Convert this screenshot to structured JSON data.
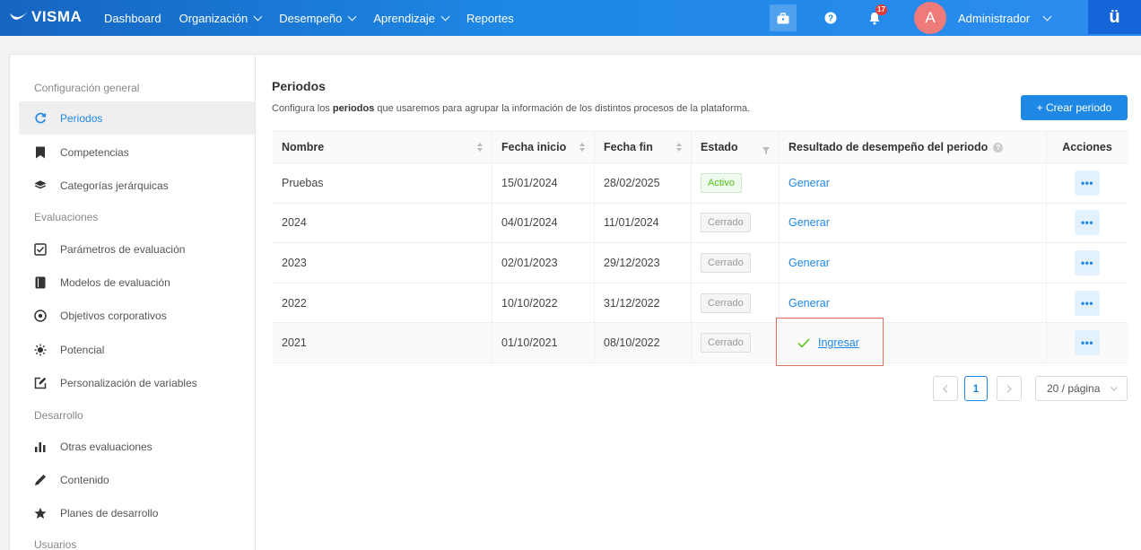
{
  "topbar": {
    "brand": "VISMA",
    "nav": [
      {
        "label": "Dashboard",
        "has_menu": false
      },
      {
        "label": "Organización",
        "has_menu": true
      },
      {
        "label": "Desempeño",
        "has_menu": true
      },
      {
        "label": "Aprendizaje",
        "has_menu": true
      },
      {
        "label": "Reportes",
        "has_menu": false
      }
    ],
    "notification_count": "17",
    "avatar_initial": "A",
    "user_name": "Administrador",
    "app_badge": "ü"
  },
  "sidebar": {
    "sections": [
      {
        "title": "Configuración general",
        "items": [
          {
            "label": "Periodos",
            "icon": "refresh-icon",
            "active": true
          },
          {
            "label": "Competencias",
            "icon": "bookmark-icon"
          },
          {
            "label": "Categorías jerárquicas",
            "icon": "layers-icon"
          }
        ]
      },
      {
        "title": "Evaluaciones",
        "items": [
          {
            "label": "Parámetros de evaluación",
            "icon": "checkbox-icon"
          },
          {
            "label": "Modelos de evaluación",
            "icon": "notebook-icon"
          },
          {
            "label": "Objetivos corporativos",
            "icon": "target-icon"
          },
          {
            "label": "Potencial",
            "icon": "sun-icon"
          },
          {
            "label": "Personalización de variables",
            "icon": "edit-icon"
          }
        ]
      },
      {
        "title": "Desarrollo",
        "items": [
          {
            "label": "Otras evaluaciones",
            "icon": "bar-chart-icon"
          },
          {
            "label": "Contenido",
            "icon": "pen-icon"
          },
          {
            "label": "Planes de desarrollo",
            "icon": "star-icon"
          }
        ]
      },
      {
        "title": "Usuarios",
        "items": []
      }
    ]
  },
  "main": {
    "title": "Periodos",
    "description_pre": "Configura los ",
    "description_bold": "periodos",
    "description_post": " que usaremos para agrupar la información de los distintos procesos de la plataforma.",
    "create_button": "+ Crear periodo",
    "table": {
      "headers": [
        "Nombre",
        "Fecha inicio",
        "Fecha fin",
        "Estado",
        "Resultado de desempeño del periodo",
        "Acciones"
      ],
      "rows": [
        {
          "nombre": "Pruebas",
          "inicio": "15/01/2024",
          "fin": "28/02/2025",
          "estado": "Activo",
          "resultado": "Generar"
        },
        {
          "nombre": "2024",
          "inicio": "04/01/2024",
          "fin": "11/01/2024",
          "estado": "Cerrado",
          "resultado": "Generar"
        },
        {
          "nombre": "2023",
          "inicio": "02/01/2023",
          "fin": "29/12/2023",
          "estado": "Cerrado",
          "resultado": "Generar"
        },
        {
          "nombre": "2022",
          "inicio": "10/10/2022",
          "fin": "31/12/2022",
          "estado": "Cerrado",
          "resultado": "Generar"
        },
        {
          "nombre": "2021",
          "inicio": "01/10/2021",
          "fin": "08/10/2022",
          "estado": "Cerrado",
          "resultado": "Ingresar"
        }
      ],
      "actions_label": "•••"
    },
    "pagination": {
      "current_page": "1",
      "page_size": "20 / página"
    }
  },
  "colors": {
    "accent": "#1e88e5",
    "active_tag": "#52c41a",
    "highlight": "#e07060"
  }
}
